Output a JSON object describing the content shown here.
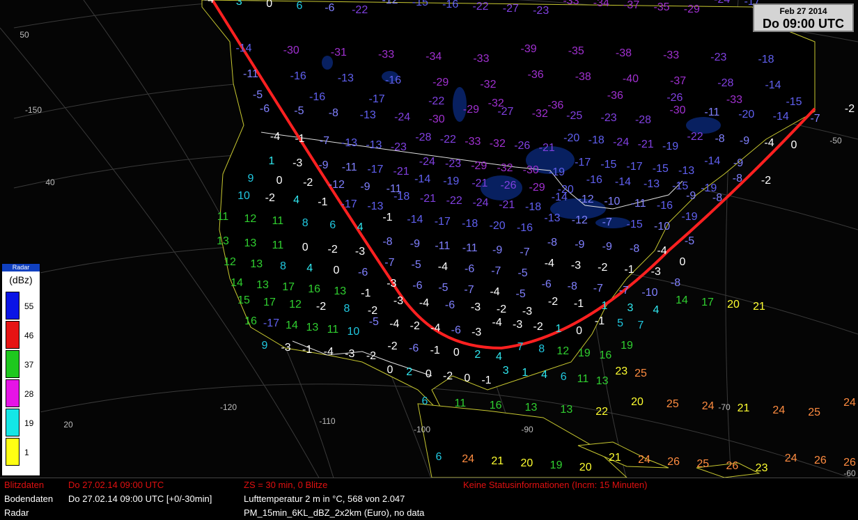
{
  "header": {
    "date": "Feb 27 2014",
    "time": "Do 09:00 UTC"
  },
  "legend": {
    "title": "Radar",
    "unit": "(dBz)",
    "levels": [
      {
        "label": "55",
        "color": "#0a14e6"
      },
      {
        "label": "46",
        "color": "#e61414"
      },
      {
        "label": "37",
        "color": "#1ec81e"
      },
      {
        "label": "28",
        "color": "#e614e6"
      },
      {
        "label": "19",
        "color": "#14e6e6"
      },
      {
        "label": "1",
        "color": "#ffff14"
      }
    ]
  },
  "grid_labels": [
    "50",
    "-150",
    "40",
    "-120",
    "20",
    "-110",
    "-100",
    "-90",
    "-70",
    "-60",
    "-50"
  ],
  "temperatures": [
    "-4",
    "3",
    "0",
    "6",
    "-6",
    "-22",
    "-12",
    "-15",
    "-16",
    "-22",
    "-27",
    "-23",
    "-33",
    "-34",
    "-37",
    "-35",
    "-29",
    "-24",
    "-17",
    "-14",
    "-30",
    "-31",
    "-33",
    "-34",
    "-33",
    "-39",
    "-35",
    "-38",
    "-33",
    "-23",
    "-18",
    "-11",
    "-16",
    "-13",
    "-16",
    "-29",
    "-32",
    "-36",
    "-38",
    "-40",
    "-37",
    "-28",
    "-14",
    "-5",
    "-16",
    "-17",
    "-22",
    "-32",
    "-36",
    "-36",
    "-26",
    "-33",
    "-15",
    "-6",
    "-5",
    "-8",
    "-13",
    "-24",
    "-30",
    "-29",
    "-27",
    "-32",
    "-25",
    "-23",
    "-28",
    "-30",
    "-11",
    "-20",
    "-14",
    "-7",
    "-2",
    "-4",
    "-1",
    "-7",
    "-13",
    "-13",
    "-23",
    "-28",
    "-22",
    "-33",
    "-32",
    "-26",
    "-21",
    "-20",
    "-18",
    "-24",
    "-21",
    "-19",
    "-22",
    "-8",
    "-9",
    "-4",
    "0",
    "1",
    "-3",
    "-9",
    "-11",
    "-17",
    "-21",
    "-24",
    "-23",
    "-29",
    "-32",
    "-30",
    "-19",
    "-17",
    "-15",
    "-17",
    "-15",
    "-13",
    "-14",
    "-9",
    "9",
    "0",
    "-2",
    "-12",
    "-9",
    "-11",
    "-14",
    "-19",
    "-21",
    "-26",
    "-29",
    "-20",
    "-16",
    "-14",
    "-13",
    "-15",
    "-19",
    "-8",
    "-2",
    "10",
    "-2",
    "4",
    "-1",
    "-17",
    "-13",
    "-18",
    "-21",
    "-22",
    "-24",
    "-21",
    "-18",
    "-14",
    "-12",
    "-10",
    "-11",
    "-16",
    "-9",
    "-8",
    "11",
    "12",
    "11",
    "8",
    "6",
    "4",
    "-1",
    "-14",
    "-17",
    "-18",
    "-20",
    "-16",
    "-13",
    "-12",
    "-7",
    "-15",
    "-10",
    "-19",
    "13",
    "13",
    "11",
    "0",
    "-2",
    "-3",
    "-8",
    "-9",
    "-11",
    "-11",
    "-9",
    "-7",
    "-8",
    "-9",
    "-9",
    "-8",
    "-4",
    "-5",
    "12",
    "13",
    "8",
    "4",
    "0",
    "-6",
    "-7",
    "-5",
    "-4",
    "-6",
    "-7",
    "-5",
    "-4",
    "-3",
    "-2",
    "-1",
    "-3",
    "0",
    "14",
    "13",
    "17",
    "16",
    "13",
    "-1",
    "-3",
    "-6",
    "-5",
    "-7",
    "-4",
    "-5",
    "-6",
    "-8",
    "-7",
    "-7",
    "-10",
    "-8",
    "15",
    "17",
    "12",
    "-2",
    "8",
    "-2",
    "-3",
    "-4",
    "-6",
    "-3",
    "-2",
    "-3",
    "-2",
    "-1",
    "1",
    "3",
    "4",
    "14",
    "17",
    "20",
    "21",
    "16",
    "-17",
    "14",
    "13",
    "11",
    "10",
    "-5",
    "-4",
    "-2",
    "-4",
    "-6",
    "-3",
    "-4",
    "-3",
    "-2",
    "1",
    "0",
    "-1",
    "5",
    "7",
    "9",
    "-3",
    "-1",
    "-4",
    "-3",
    "-2",
    "-2",
    "-6",
    "-1",
    "0",
    "2",
    "4",
    "7",
    "8",
    "12",
    "19",
    "16",
    "19",
    "0",
    "2",
    "0",
    "-2",
    "0",
    "-1",
    "3",
    "1",
    "4",
    "6",
    "11",
    "13",
    "23",
    "25",
    "6",
    "11",
    "16",
    "13",
    "13",
    "22",
    "20",
    "25",
    "24",
    "21",
    "24",
    "25",
    "24",
    "6",
    "24",
    "21",
    "20",
    "19",
    "20",
    "21",
    "24",
    "26",
    "25",
    "26",
    "23",
    "24",
    "26",
    "26"
  ],
  "lightning_dots_visible": true,
  "status": {
    "rows": [
      {
        "name": "Blitzdaten",
        "time": "Do 27.02.14 09:00 UTC",
        "info": "ZS = 30 min, 0 Blitze",
        "extra": "Keine Statusinformationen (Incm: 15 Minuten)"
      },
      {
        "name": "Bodendaten",
        "time": "Do 27.02.14 09:00 UTC [+0/-30min]",
        "info": "Lufttemperatur 2 m in °C, 568 von 2.047",
        "extra": ""
      },
      {
        "name": "Radar",
        "time": "",
        "info": "PM_15min_6KL_dBZ_2x2km (Euro), no data",
        "extra": ""
      }
    ],
    "colors": {
      "red": "#e01010",
      "white": "#ffffff"
    }
  }
}
